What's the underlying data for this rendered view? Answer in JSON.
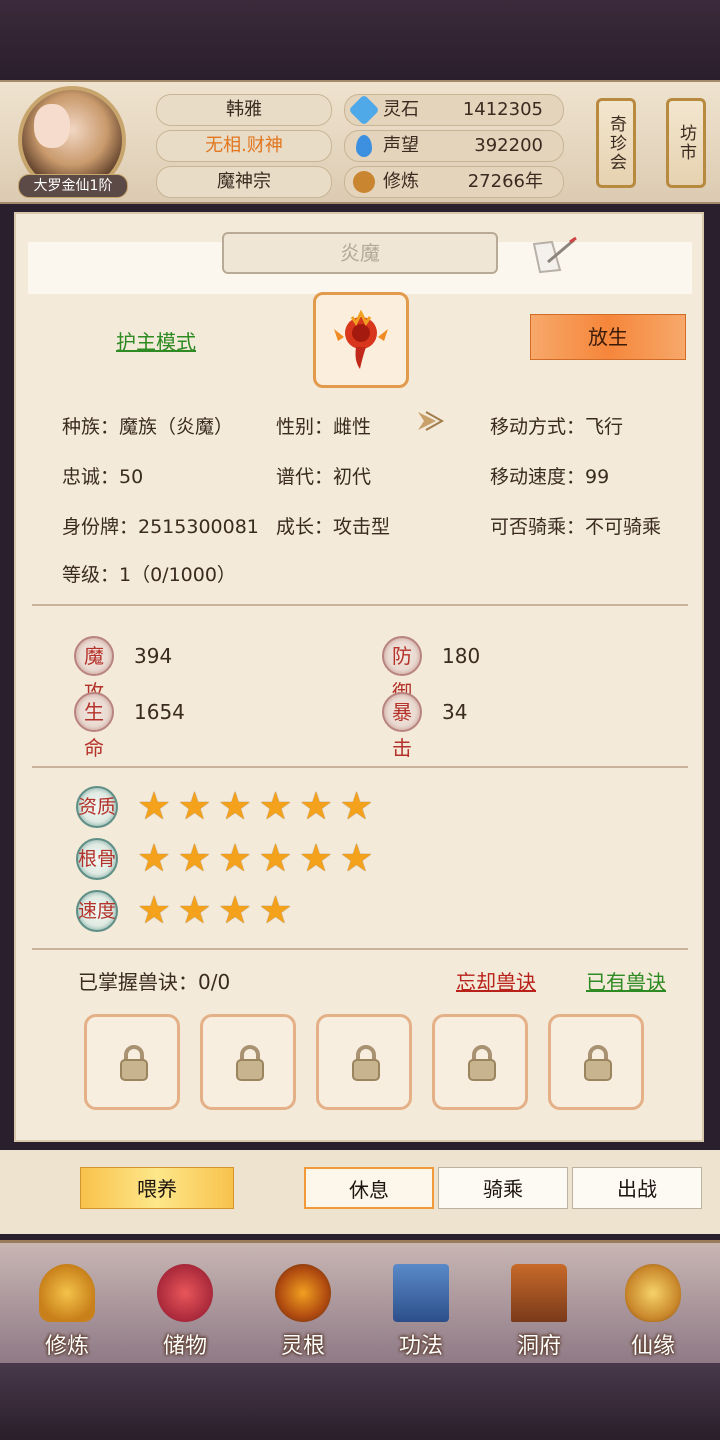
{
  "header": {
    "rank_badge": "大罗金仙1阶",
    "player_name": "韩雅",
    "title": "无相.财神",
    "sect": "魔神宗",
    "resources": [
      {
        "label": "灵石",
        "value": "1412305",
        "icon": "spirit-stone-icon",
        "color": "#4fa8e8"
      },
      {
        "label": "声望",
        "value": "392200",
        "icon": "crystal-icon",
        "color": "#3d8fe0"
      },
      {
        "label": "修炼",
        "value": "27266年",
        "icon": "meditation-icon",
        "color": "#c9852f"
      }
    ],
    "buttons": {
      "treasure": "奇珍会",
      "market": "坊市"
    }
  },
  "pet": {
    "name": "炎魔",
    "guard_mode": "护主模式",
    "release": "放生",
    "info": {
      "race": "种族：魔族（炎魔）",
      "gender": "性别：雌性",
      "move_type": "移动方式：飞行",
      "loyalty": "忠诚：50",
      "generation": "谱代：初代",
      "move_speed": "移动速度：99",
      "id_tag": "身份牌：2515300081",
      "growth": "成长：攻击型",
      "rideable": "可否骑乘：不可骑乘",
      "level": "等级：1（0/1000）"
    },
    "stats": [
      {
        "label": "魔攻",
        "value": "394"
      },
      {
        "label": "防御",
        "value": "180"
      },
      {
        "label": "生命",
        "value": "1654"
      },
      {
        "label": "暴击",
        "value": "34"
      }
    ],
    "aptitudes": [
      {
        "label": "资质",
        "stars": 6
      },
      {
        "label": "根骨",
        "stars": 6
      },
      {
        "label": "速度",
        "stars": 4
      }
    ],
    "skills": {
      "mastered": "已掌握兽诀：0/0",
      "forget": "忘却兽诀",
      "owned": "已有兽诀"
    }
  },
  "actions": {
    "feed": "喂养",
    "rest": "休息",
    "ride": "骑乘",
    "fight": "出战"
  },
  "nav": [
    "修炼",
    "储物",
    "灵根",
    "功法",
    "洞府",
    "仙缘"
  ]
}
